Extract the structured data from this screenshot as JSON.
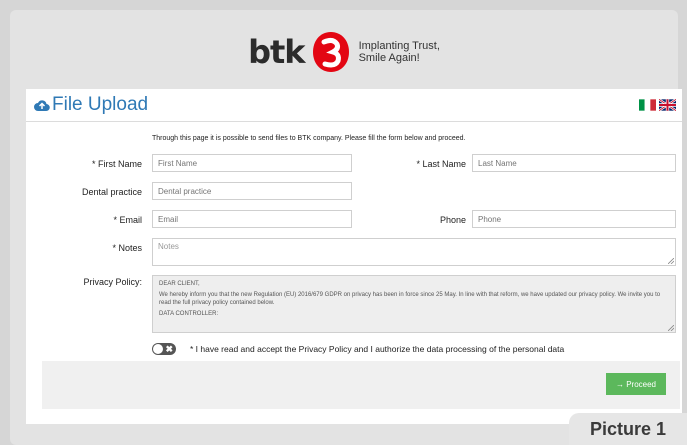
{
  "brand": {
    "wordmark": "btk",
    "tagline_line1": "Implanting Trust,",
    "tagline_line2": "Smile Again!",
    "logo_color": "#e30613"
  },
  "panel": {
    "title": "File Upload",
    "title_icon": "cloud-upload-icon",
    "languages": [
      "it",
      "en"
    ]
  },
  "intro": "Through this page it is possible to send files to BTK company. Please fill the form below and proceed.",
  "form": {
    "first_name": {
      "label": "* First Name",
      "placeholder": "First Name",
      "value": ""
    },
    "last_name": {
      "label": "* Last Name",
      "placeholder": "Last Name",
      "value": ""
    },
    "dental_practice": {
      "label": "Dental practice",
      "placeholder": "Dental practice",
      "value": ""
    },
    "email": {
      "label": "* Email",
      "placeholder": "Email",
      "value": ""
    },
    "phone": {
      "label": "Phone",
      "placeholder": "Phone",
      "value": ""
    },
    "notes": {
      "label": "* Notes",
      "placeholder": "Notes",
      "value": ""
    }
  },
  "privacy": {
    "label": "Privacy Policy:",
    "line1": "DEAR CLIENT,",
    "line2": "We hereby inform you that the new Regulation (EU) 2016/679 GDPR on privacy has been in force since 25 May. In line with that reform, we have updated our privacy policy. We invite you to read the full privacy policy contained below.",
    "line3": "DATA CONTROLLER:"
  },
  "consent": {
    "text": "* I have read and accept the Privacy Policy and I authorize the data processing of the personal data",
    "checked": false,
    "toggle_glyph": "✖"
  },
  "actions": {
    "proceed_label": "→ Proceed",
    "proceed_color": "#5cb85c"
  },
  "caption": "Picture 1",
  "colors": {
    "accent": "#2f79b5",
    "background": "#d6d6d6"
  }
}
